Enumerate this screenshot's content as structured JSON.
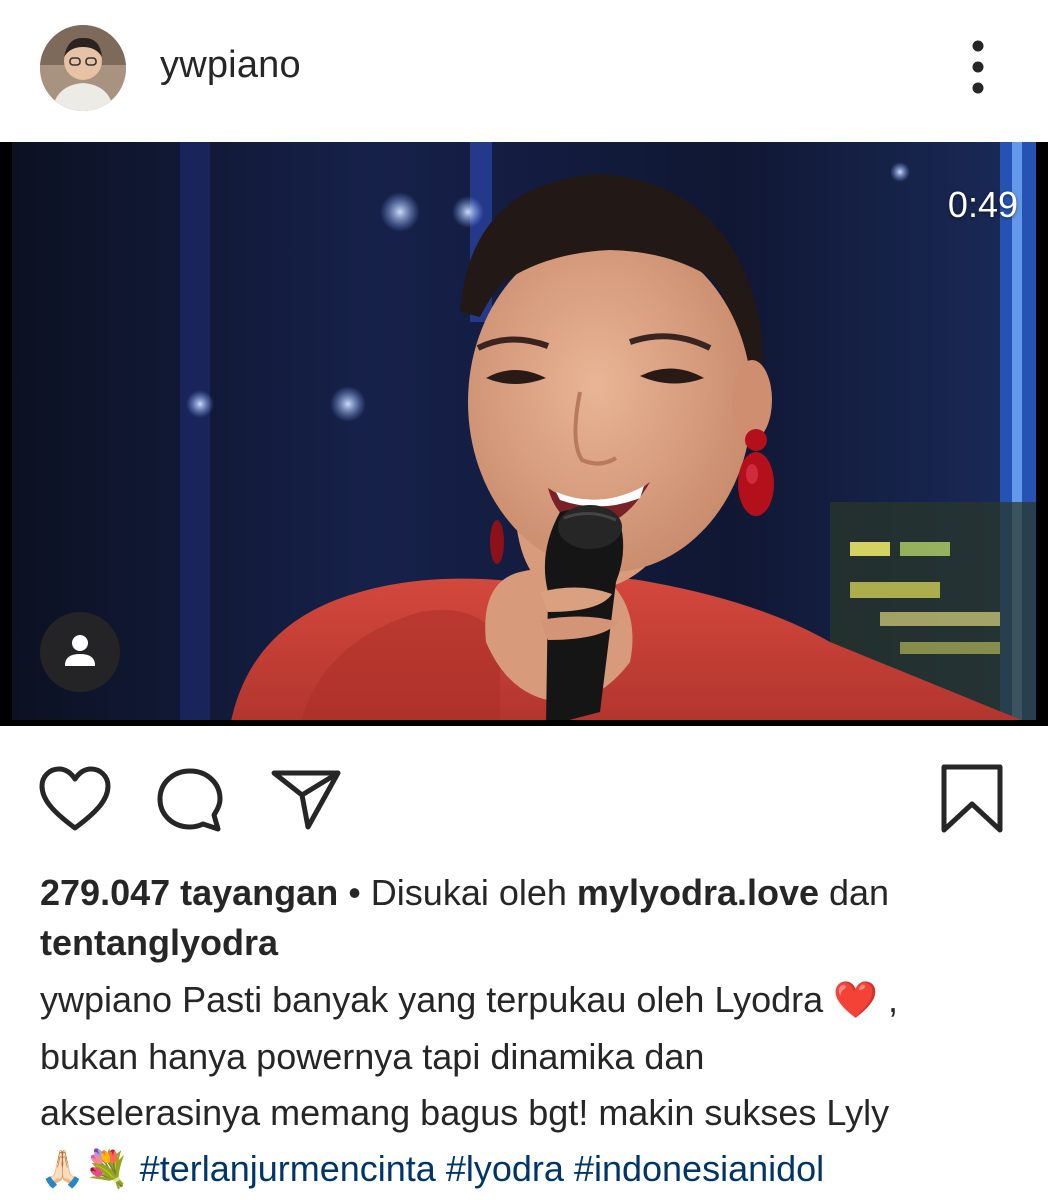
{
  "post": {
    "username": "ywpiano",
    "video": {
      "duration": "0:49"
    },
    "views": "279.047 tayangan",
    "separator": " • ",
    "liked_by_prefix": "Disukai oleh ",
    "liked_by_user_1": "mylyodra.love",
    "liked_by_joiner": " dan",
    "liked_by_user_2": "tentanglyodra",
    "caption": {
      "author": "ywpiano",
      "text_line_1": " Pasti banyak yang terpukau oleh Lyodra ",
      "heart_emoji": "❤️",
      "text_after_heart": " ,",
      "text_line_2": "bukan hanya powernya tapi dinamika dan",
      "text_line_3": "akselerasinya memang bagus bgt! makin sukses Lyly",
      "emojis": "🙏🏻💐",
      "hashtags": [
        "#terlanjurmencinta",
        "#lyodra",
        "#indonesianidol"
      ]
    }
  },
  "icons": {
    "more": "more-vertical-icon",
    "tag": "person-tag-icon",
    "like": "heart-outline-icon",
    "comment": "comment-bubble-icon",
    "share": "paper-plane-icon",
    "save": "bookmark-outline-icon"
  },
  "colors": {
    "text": "#262626",
    "hashtag": "#003569",
    "dress": "#c63d34",
    "earring": "#b3101c"
  }
}
